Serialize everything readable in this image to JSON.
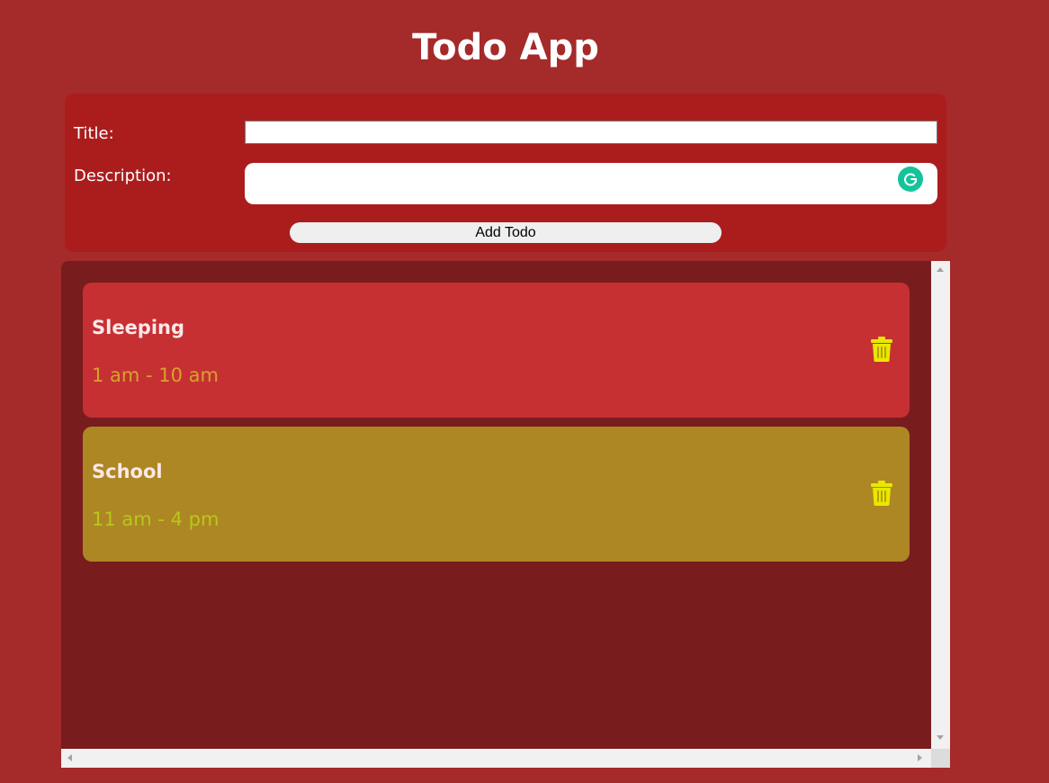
{
  "app": {
    "title": "Todo App"
  },
  "form": {
    "title_label": "Title:",
    "title_value": "",
    "description_label": "Description:",
    "description_value": "",
    "add_button_label": "Add Todo"
  },
  "todos": [
    {
      "title": "Sleeping",
      "time": "1 am - 10 am",
      "color": "#c63033",
      "delete_icon": "trash-icon"
    },
    {
      "title": "School",
      "time": "11 am - 4 pm",
      "color": "#ad8723",
      "delete_icon": "trash-icon"
    }
  ],
  "icons": {
    "grammarly": "grammarly-icon",
    "delete": "trash-icon",
    "delete_color": "#e8e800"
  },
  "colors": {
    "background": "#a52a2a",
    "form_background": "#ab1d1d",
    "list_background": "#781c1e"
  }
}
